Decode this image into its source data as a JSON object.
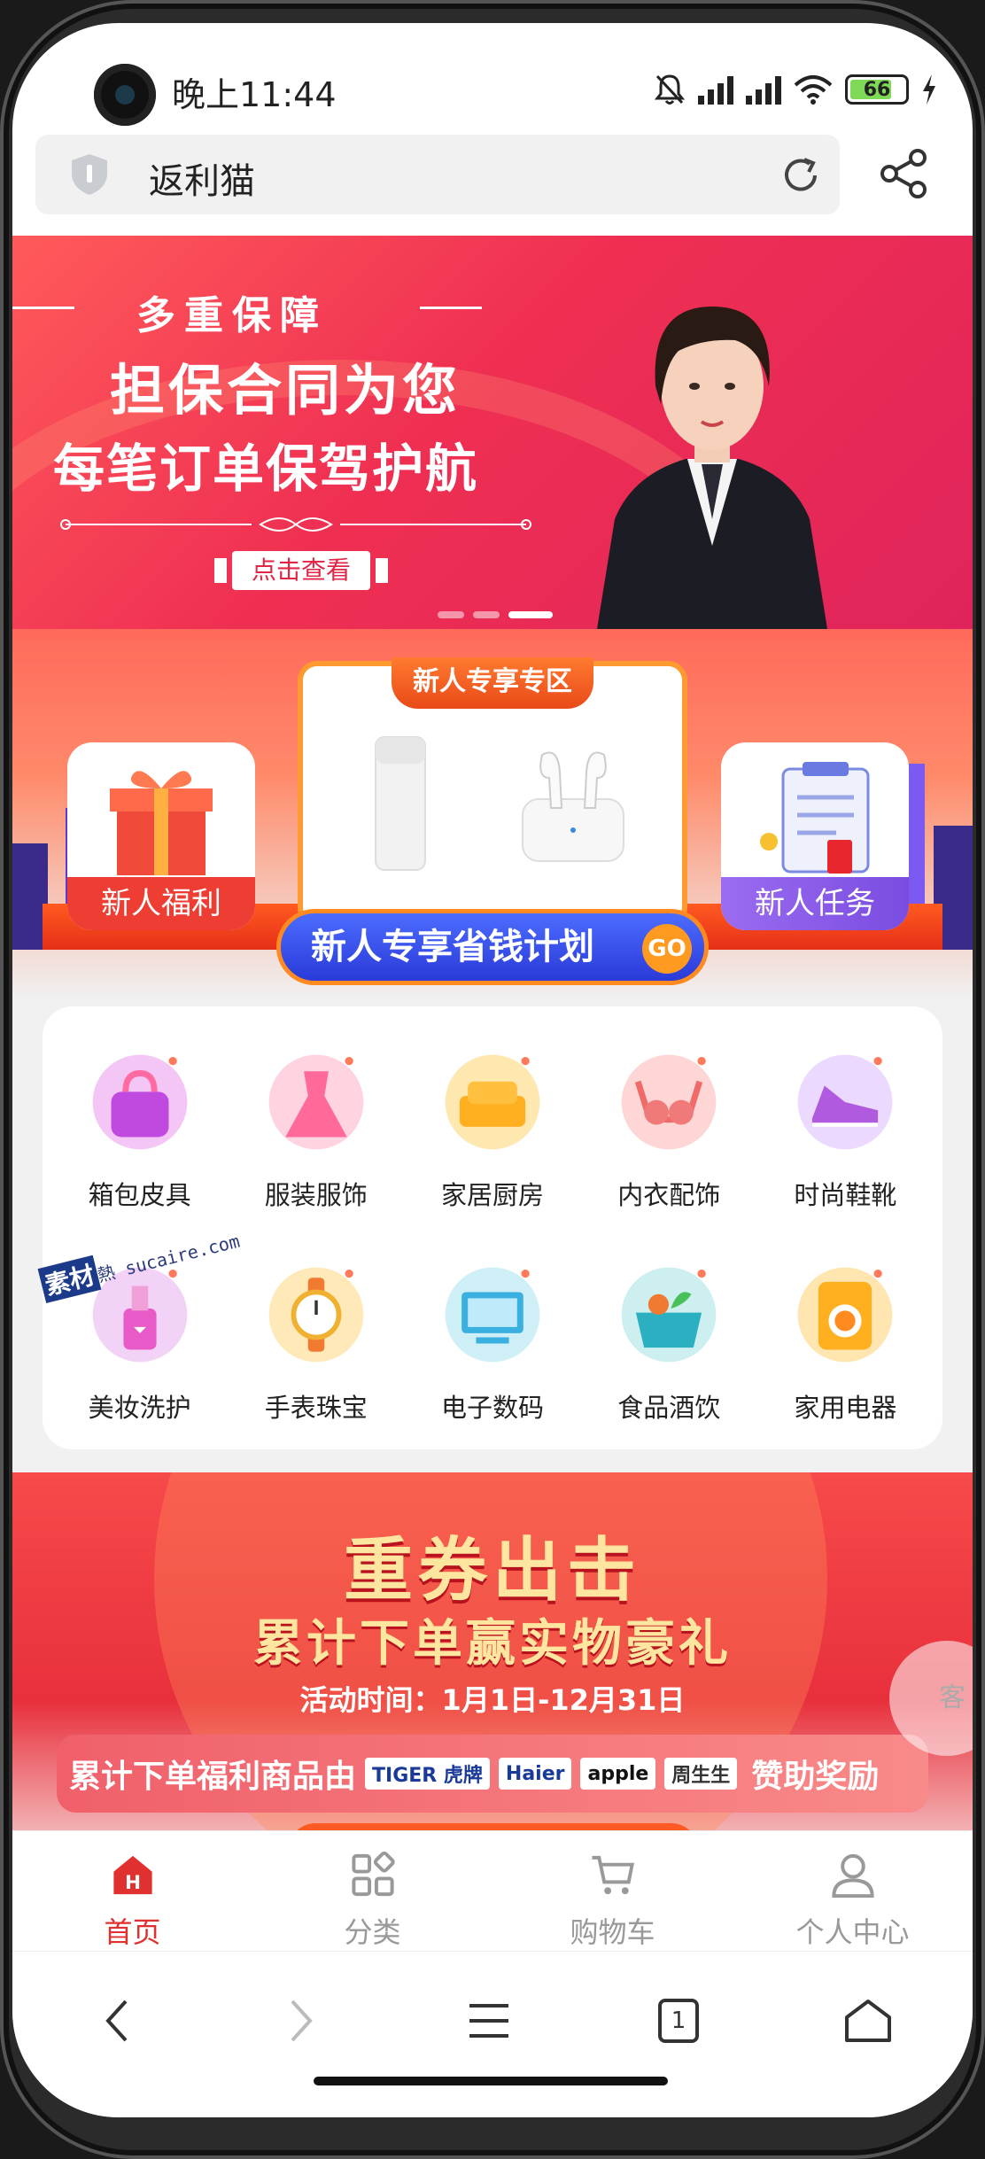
{
  "status_bar": {
    "time": "晚上11:44",
    "battery": "66"
  },
  "address_bar": {
    "title": "返利猫"
  },
  "hero_banner": {
    "tag": "多重保障",
    "line1": "担保合同为您",
    "line2": "每笔订单保驾护航",
    "button": "点击查看",
    "slides": 3,
    "active_slide": 3
  },
  "promo_zone": {
    "center_tag": "新人专享专区",
    "left_card": "新人福利",
    "right_card": "新人任务",
    "plan_button": "新人专享省钱计划",
    "go_label": "GO"
  },
  "categories": [
    {
      "label": "箱包皮具",
      "icon": "handbag-icon",
      "color": "#f3c6f5"
    },
    {
      "label": "服装服饰",
      "icon": "dress-icon",
      "color": "#ffd3e0"
    },
    {
      "label": "家居厨房",
      "icon": "sofa-icon",
      "color": "#ffe8b0"
    },
    {
      "label": "内衣配饰",
      "icon": "underwear-icon",
      "color": "#ffd6d6"
    },
    {
      "label": "时尚鞋靴",
      "icon": "sneaker-icon",
      "color": "#ecd9ff"
    },
    {
      "label": "美妆洗护",
      "icon": "cosmetics-icon",
      "color": "#f3d2f7"
    },
    {
      "label": "手表珠宝",
      "icon": "watch-icon",
      "color": "#ffe9b8"
    },
    {
      "label": "电子数码",
      "icon": "monitor-icon",
      "color": "#cdeff5"
    },
    {
      "label": "食品酒饮",
      "icon": "food-basket-icon",
      "color": "#cdeff0"
    },
    {
      "label": "家用电器",
      "icon": "washing-machine-icon",
      "color": "#ffe6b0"
    }
  ],
  "watermark": {
    "brand": "素材",
    "text": "熱",
    "url": "sucaire.com"
  },
  "coupon_banner": {
    "title": "重券出击",
    "subtitle": "累计下单赢实物豪礼",
    "time": "活动时间：1月1日-12月31日",
    "strip_lead": "累计下单福利商品由",
    "brands": [
      "TIGER 虎牌",
      "Haier",
      "apple",
      "周生生"
    ],
    "strip_tail": "赞助奖励"
  },
  "floating_service": {
    "label": "客"
  },
  "bottom_nav": [
    {
      "label": "首页",
      "icon": "home-icon",
      "active": true
    },
    {
      "label": "分类",
      "icon": "category-icon",
      "active": false
    },
    {
      "label": "购物车",
      "icon": "cart-icon",
      "active": false
    },
    {
      "label": "个人中心",
      "icon": "user-icon",
      "active": false
    }
  ],
  "browser_bar": {
    "tab_count": "1"
  },
  "colors": {
    "accent": "#e03030",
    "hero": "#ef2f52",
    "coupon_text": "#ffe6a0"
  }
}
